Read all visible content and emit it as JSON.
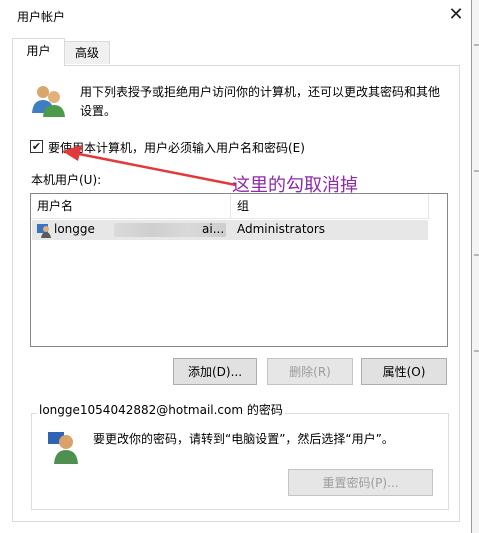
{
  "window": {
    "title": "用户帐户"
  },
  "tabs": [
    {
      "label": "用户",
      "active": true
    },
    {
      "label": "高级",
      "active": false
    }
  ],
  "description": "用下列表授予或拒绝用户访问你的计算机，还可以更改其密码和其他设置。",
  "checkbox": {
    "label": "要使用本计算机，用户必须输入用户名和密码(E)",
    "checked": true
  },
  "annotation": {
    "text": "这里的勾取消掉",
    "color": "#8e2aa8"
  },
  "users_list": {
    "label": "本机用户(U):",
    "columns": [
      "用户名",
      "组"
    ],
    "rows": [
      {
        "name_start": "longge",
        "name_end": "ai...",
        "group": "Administrators"
      }
    ]
  },
  "buttons": {
    "add": "添加(D)...",
    "remove": "删除(R)",
    "properties": "属性(O)"
  },
  "password_group": {
    "legend": "longge1054042882@hotmail.com 的密码",
    "text": "要更改你的密码，请转到“电脑设置”，然后选择“用户”。",
    "reset_button": "重置密码(P)..."
  },
  "icons": {
    "users": "users-icon",
    "user_row": "user-account-icon",
    "key": "user-key-icon",
    "close": "close-icon"
  }
}
